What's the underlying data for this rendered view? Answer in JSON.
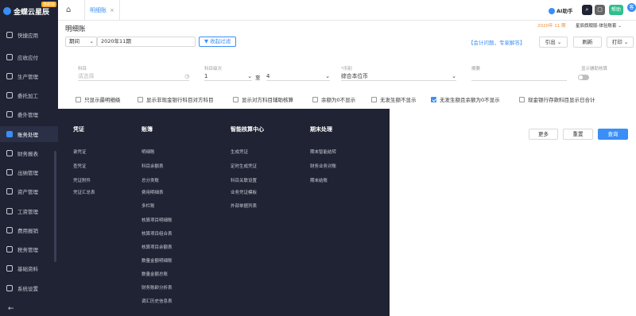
{
  "brand": {
    "name": "金蝶云星辰",
    "badge": "旗舰版"
  },
  "sidebar": {
    "items": [
      {
        "label": "快捷应用"
      },
      {
        "label": "应收应付"
      },
      {
        "label": "生产管理"
      },
      {
        "label": "委托加工"
      },
      {
        "label": "委外管理"
      },
      {
        "label": "账务处理"
      },
      {
        "label": "财务报表"
      },
      {
        "label": "出纳管理"
      },
      {
        "label": "资产管理"
      },
      {
        "label": "工资管理"
      },
      {
        "label": "费用报销"
      },
      {
        "label": "税务管理"
      },
      {
        "label": "基础资料"
      },
      {
        "label": "系统设置"
      }
    ],
    "active_index": 5,
    "collapse_icon": "arrow-left-icon"
  },
  "topbar": {
    "tab": "明细账",
    "ai_label": "AI助手",
    "help_label": "帮助",
    "user_initial": "客"
  },
  "header": {
    "title": "明细账",
    "period_info": "2020年 11 期",
    "account_info": "星辰旗舰版-体验账套"
  },
  "toolbar": {
    "period_select": "期间",
    "period_value": "2020年11期",
    "collapse_filter": "收起过滤",
    "help_link": "【会计问题，专家解答】",
    "print_preview": "引出",
    "refresh": "刷新",
    "print": "打印"
  },
  "filters": {
    "account_label": "科目",
    "account_placeholder": "请选择",
    "level_label": "科目级次",
    "level_from": "1",
    "level_to_word": "至",
    "level_to": "4",
    "currency_label": "*币别",
    "currency_value": "综合本位币",
    "summary_label": "摘要",
    "aux_label": "显示辅助核算"
  },
  "checkboxes": [
    {
      "label": "只显示最明细级",
      "checked": false
    },
    {
      "label": "显示非现金银行科目对方科目",
      "checked": false
    },
    {
      "label": "显示对方科目辅助核算",
      "checked": false
    },
    {
      "label": "余额为0不显示",
      "checked": false
    },
    {
      "label": "无发生额不显示",
      "checked": false
    },
    {
      "label": "无发生额且余额为0不显示",
      "checked": true
    },
    {
      "label": "现金银行存款科目显示日合计",
      "checked": false
    }
  ],
  "actions": {
    "more": "更多",
    "reset": "重置",
    "query": "查询"
  },
  "menu": {
    "columns": [
      {
        "title": "凭证",
        "items": [
          "录凭证",
          "查凭证",
          "凭证附件",
          "凭证汇总表"
        ]
      },
      {
        "title": "账簿",
        "items": [
          "明细账",
          "科目余额表",
          "总分类账",
          "费用明细表",
          "多栏账",
          "核算项目明细账",
          "核算项目组合表",
          "核算项目余额表",
          "数量金额明细账",
          "数量金额总账",
          "财务账龄分析表",
          "调汇历史信息表"
        ]
      },
      {
        "title": "智能核算中心",
        "items": [
          "生成凭证",
          "定时生成凭证",
          "科目关联设置",
          "业务凭证模板",
          "外部单据列表"
        ]
      },
      {
        "title": "期末处理",
        "items": [
          "期末智能结转",
          "财务业务对账",
          "期末结账"
        ]
      }
    ]
  },
  "colors": {
    "accent": "#3a8ef6",
    "sidebar_bg": "#1f2333",
    "period_orange": "#f08c2e"
  }
}
